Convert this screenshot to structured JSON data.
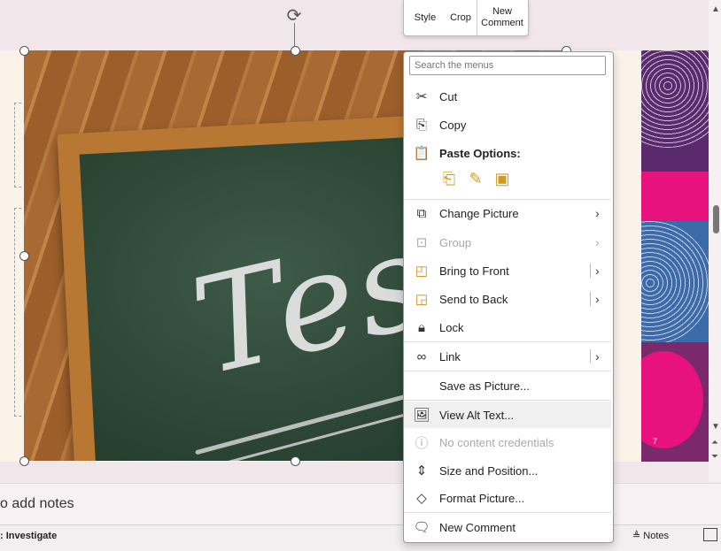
{
  "mini_toolbar": {
    "style_label": "Style",
    "crop_label": "Crop",
    "new_comment_label_1": "New",
    "new_comment_label_2": "Comment"
  },
  "slide": {
    "picture_text": "Test",
    "thumbnail_number": "7"
  },
  "context_menu": {
    "search_placeholder": "Search the menus",
    "items": {
      "cut": "Cut",
      "copy": "Copy",
      "paste_options": "Paste Options:",
      "change_picture": "Change Picture",
      "group": "Group",
      "bring_to_front": "Bring to Front",
      "send_to_back": "Send to Back",
      "lock": "Lock",
      "link": "Link",
      "save_as_picture": "Save as Picture...",
      "view_alt_text": "View Alt Text...",
      "no_content_credentials": "No content credentials",
      "size_and_position": "Size and Position...",
      "format_picture": "Format Picture...",
      "new_comment": "New Comment"
    }
  },
  "notes": {
    "placeholder": "o add notes"
  },
  "status_bar": {
    "left_text": ": Investigate",
    "notes_label": "Notes"
  },
  "icons": {
    "cut": "scissors-icon",
    "copy": "copy-icon",
    "paste": "clipboard-icon",
    "change_picture": "change-picture-icon",
    "group": "group-icon",
    "bring_to_front": "bring-front-icon",
    "send_to_back": "send-back-icon",
    "lock": "lock-icon",
    "link": "link-icon",
    "alt_text": "alt-text-icon",
    "info": "info-icon",
    "size": "size-icon",
    "format": "format-icon",
    "comment": "comment-icon"
  },
  "colors": {
    "accent_pink": "#e8127f",
    "accent_purple": "#5b2a6e",
    "accent_blue": "#3d6aa8"
  }
}
